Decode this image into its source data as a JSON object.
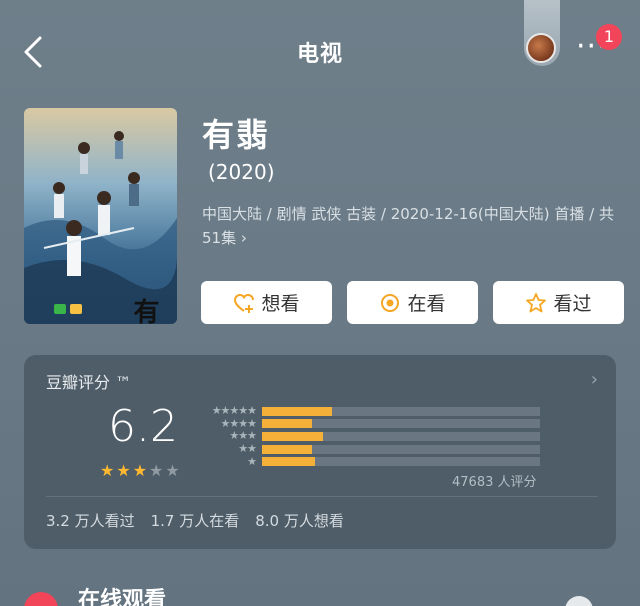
{
  "header": {
    "title": "电视",
    "badge_count": "1",
    "more_label": "···"
  },
  "movie": {
    "title": "有翡",
    "year": "(2020)",
    "meta": "中国大陆 / 剧情 武侠 古装 / 2020-12-16(中国大陆) 首播 / 共51集 ›",
    "poster_title": "有翡"
  },
  "actions": [
    {
      "label": "想看",
      "icon": "heart-plus-icon"
    },
    {
      "label": "在看",
      "icon": "target-icon"
    },
    {
      "label": "看过",
      "icon": "star-outline-icon"
    }
  ],
  "rating": {
    "heading": "豆瓣评分 ™",
    "score": "6.2",
    "stars_filled": 3,
    "stars_total": 5,
    "distribution": [
      {
        "stars": "★★★★★",
        "fraction": 0.25
      },
      {
        "stars": "★★★★",
        "fraction": 0.18
      },
      {
        "stars": "★★★",
        "fraction": 0.22
      },
      {
        "stars": "★★",
        "fraction": 0.18
      },
      {
        "stars": "★",
        "fraction": 0.19
      }
    ],
    "count": "47683 人评分",
    "stats": [
      "3.2 万人看过",
      "1.7 万人在看",
      "8.0 万人想看"
    ]
  },
  "section": {
    "online_title": "在线观看"
  },
  "colors": {
    "accent": "#f5b03a",
    "badge": "#f2455a",
    "card": "#4f5d68"
  }
}
